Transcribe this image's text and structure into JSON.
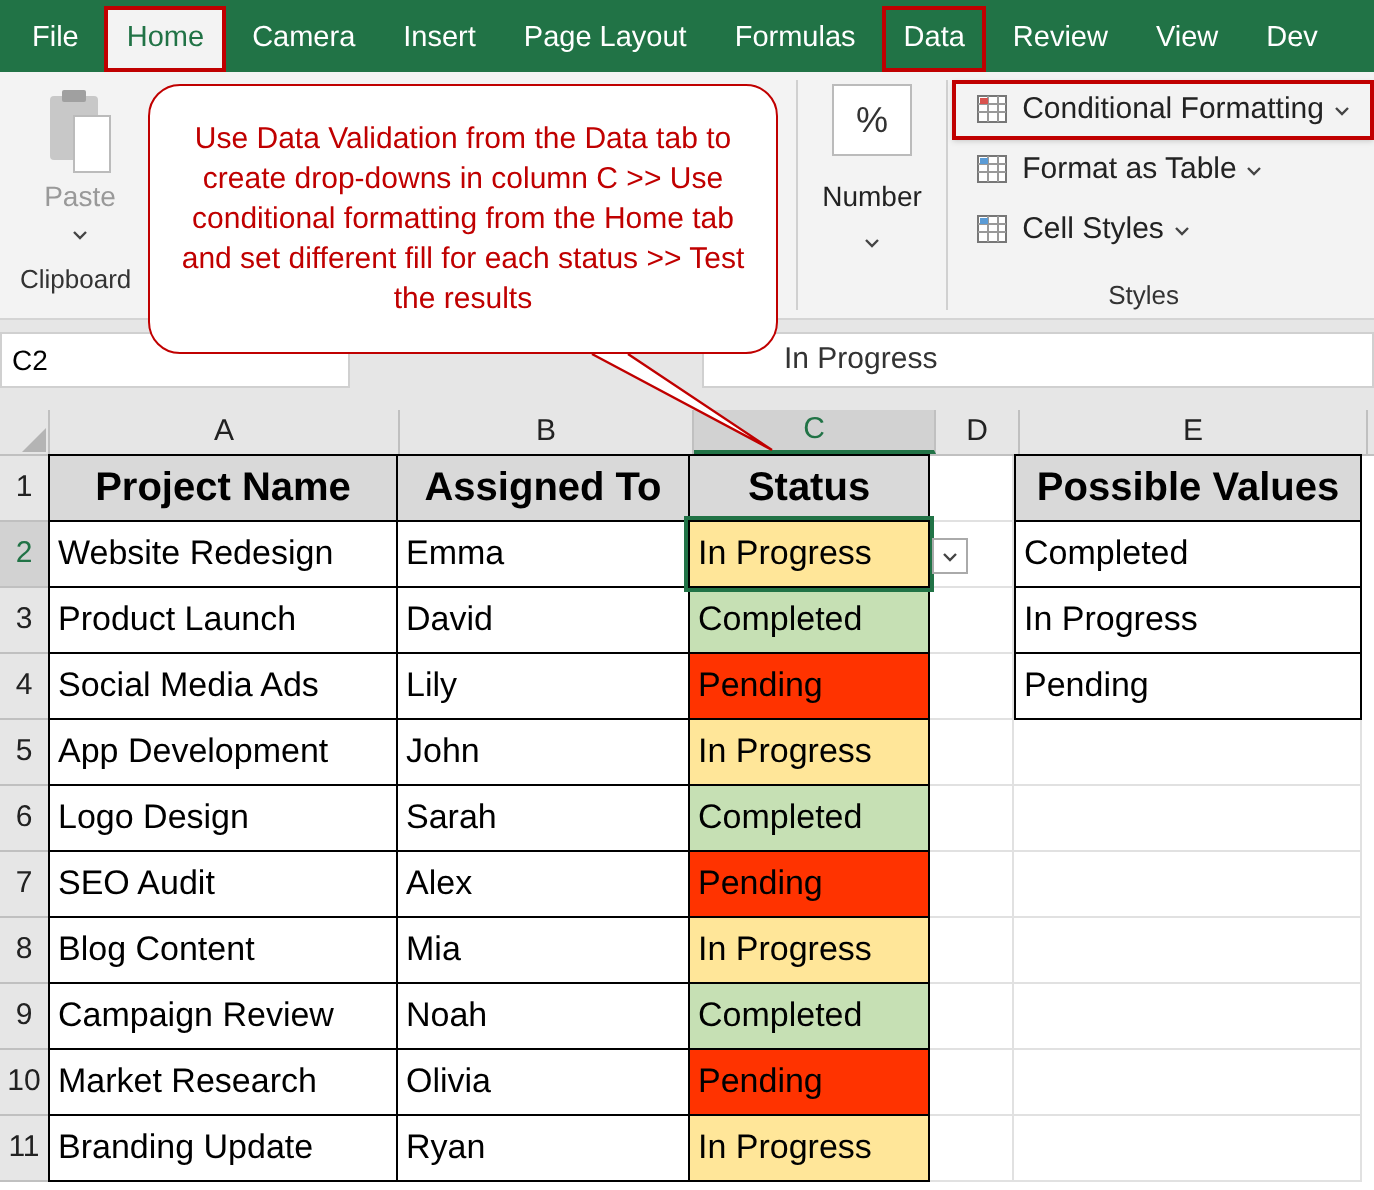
{
  "menu_tabs": [
    {
      "label": "File",
      "selected": false,
      "highlighted": false
    },
    {
      "label": "Home",
      "selected": true,
      "highlighted": true
    },
    {
      "label": "Camera",
      "selected": false,
      "highlighted": false
    },
    {
      "label": "Insert",
      "selected": false,
      "highlighted": false
    },
    {
      "label": "Page Layout",
      "selected": false,
      "highlighted": false
    },
    {
      "label": "Formulas",
      "selected": false,
      "highlighted": false
    },
    {
      "label": "Data",
      "selected": false,
      "highlighted": true
    },
    {
      "label": "Review",
      "selected": false,
      "highlighted": false
    },
    {
      "label": "View",
      "selected": false,
      "highlighted": false
    },
    {
      "label": "Dev",
      "selected": false,
      "highlighted": false
    }
  ],
  "ribbon": {
    "clipboard": {
      "paste": "Paste",
      "label": "Clipboard"
    },
    "number": {
      "symbol": "%",
      "label": "Number"
    },
    "styles": {
      "items": [
        {
          "label": "Conditional Formatting",
          "highlighted": true
        },
        {
          "label": "Format as Table",
          "highlighted": false
        },
        {
          "label": "Cell Styles",
          "highlighted": false
        }
      ],
      "label": "Styles"
    }
  },
  "callout": {
    "text": "Use Data Validation from the Data tab to create drop-downs in column C >> Use conditional formatting from the Home tab and set different fill for each status >> Test the results"
  },
  "formula_bar": {
    "name_box": "C2",
    "value": "In Progress"
  },
  "sheet": {
    "columns": [
      {
        "label": "A",
        "selected": false
      },
      {
        "label": "B",
        "selected": false
      },
      {
        "label": "C",
        "selected": true
      },
      {
        "label": "D",
        "selected": false
      },
      {
        "label": "E",
        "selected": false
      }
    ],
    "rows": [
      {
        "number": "1",
        "selected": false,
        "cells": [
          "Project Name",
          "Assigned To",
          "Status",
          "",
          "Possible Values"
        ],
        "header": true
      },
      {
        "number": "2",
        "selected": true,
        "cells": [
          "Website Redesign",
          "Emma",
          "In Progress",
          "",
          "Completed"
        ],
        "color": "#ffe699"
      },
      {
        "number": "3",
        "selected": false,
        "cells": [
          "Product Launch",
          "David",
          "Completed",
          "",
          "In Progress"
        ],
        "color": "#c6e0b4"
      },
      {
        "number": "4",
        "selected": false,
        "cells": [
          "Social Media Ads",
          "Lily",
          "Pending",
          "",
          "Pending"
        ],
        "color": "#ff3300"
      },
      {
        "number": "5",
        "selected": false,
        "cells": [
          "App Development",
          "John",
          "In Progress"
        ],
        "color": "#ffe699"
      },
      {
        "number": "6",
        "selected": false,
        "cells": [
          "Logo Design",
          "Sarah",
          "Completed"
        ],
        "color": "#c6e0b4"
      },
      {
        "number": "7",
        "selected": false,
        "cells": [
          "SEO Audit",
          "Alex",
          "Pending"
        ],
        "color": "#ff3300"
      },
      {
        "number": "8",
        "selected": false,
        "cells": [
          "Blog Content",
          "Mia",
          "In Progress"
        ],
        "color": "#ffe699"
      },
      {
        "number": "9",
        "selected": false,
        "cells": [
          "Campaign Review",
          "Noah",
          "Completed"
        ],
        "color": "#c6e0b4"
      },
      {
        "number": "10",
        "selected": false,
        "cells": [
          "Market Research",
          "Olivia",
          "Pending"
        ],
        "color": "#ff3300"
      },
      {
        "number": "11",
        "selected": false,
        "cells": [
          "Branding Update",
          "Ryan",
          "In Progress"
        ],
        "color": "#ffe699"
      }
    ]
  }
}
